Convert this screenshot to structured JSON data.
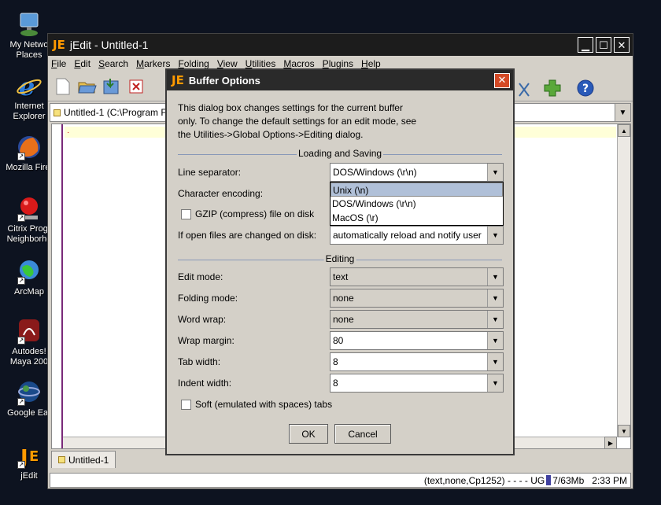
{
  "desktop": {
    "icons": [
      {
        "label": "My Netwo\nPlaces",
        "icon": "network-places-icon"
      },
      {
        "label": "Internet\nExplorer",
        "icon": "internet-explorer-icon"
      },
      {
        "label": "Mozilla Firef",
        "icon": "firefox-icon"
      },
      {
        "label": "Citrix Progr\nNeighborho",
        "icon": "citrix-icon"
      },
      {
        "label": "ArcMap",
        "icon": "arcmap-icon"
      },
      {
        "label": "Autodes!\nMaya 200",
        "icon": "maya-icon"
      },
      {
        "label": "Google Ear",
        "icon": "google-earth-icon"
      },
      {
        "label": "jEdit",
        "icon": "jedit-icon"
      }
    ]
  },
  "window": {
    "title": "jEdit - Untitled-1",
    "menus": [
      "File",
      "Edit",
      "Search",
      "Markers",
      "Folding",
      "View",
      "Utilities",
      "Macros",
      "Plugins",
      "Help"
    ],
    "buffer_path": "Untitled-1 (C:\\Program F",
    "tab_label": "Untitled-1",
    "status_text": "(text,none,Cp1252) - - - - UG",
    "memory": "7/63Mb",
    "clock": "2:33 PM"
  },
  "dialog": {
    "title": "Buffer Options",
    "intro_lines": [
      "This dialog box changes settings for the current buffer",
      "only. To change the default settings for an edit mode, see",
      "the Utilities->Global Options->Editing dialog."
    ],
    "section_loading": "Loading and Saving",
    "section_editing": "Editing",
    "line_separator": {
      "label": "Line separator:",
      "value": "DOS/Windows (\\r\\n)"
    },
    "line_separator_options": [
      "Unix (\\n)",
      "DOS/Windows (\\r\\n)",
      "MacOS (\\r)"
    ],
    "char_encoding": {
      "label": "Character encoding:"
    },
    "gzip": {
      "label": "GZIP (compress) file on disk",
      "checked": false
    },
    "open_changed": {
      "label": "If open files are changed on disk:",
      "value": "automatically reload and notify user"
    },
    "edit_mode": {
      "label": "Edit mode:",
      "value": "text"
    },
    "folding_mode": {
      "label": "Folding mode:",
      "value": "none"
    },
    "word_wrap": {
      "label": "Word wrap:",
      "value": "none"
    },
    "wrap_margin": {
      "label": "Wrap margin:",
      "value": "80"
    },
    "tab_width": {
      "label": "Tab width:",
      "value": "8"
    },
    "indent_width": {
      "label": "Indent width:",
      "value": "8"
    },
    "soft_tabs": {
      "label": "Soft (emulated with spaces) tabs",
      "checked": false
    },
    "ok_label": "OK",
    "cancel_label": "Cancel"
  },
  "colors": {
    "desktop_bg": "#0d1320",
    "dialog_bg": "#d4d0c8",
    "close_button": "#d44a26",
    "selection": "#b0c0d8"
  }
}
